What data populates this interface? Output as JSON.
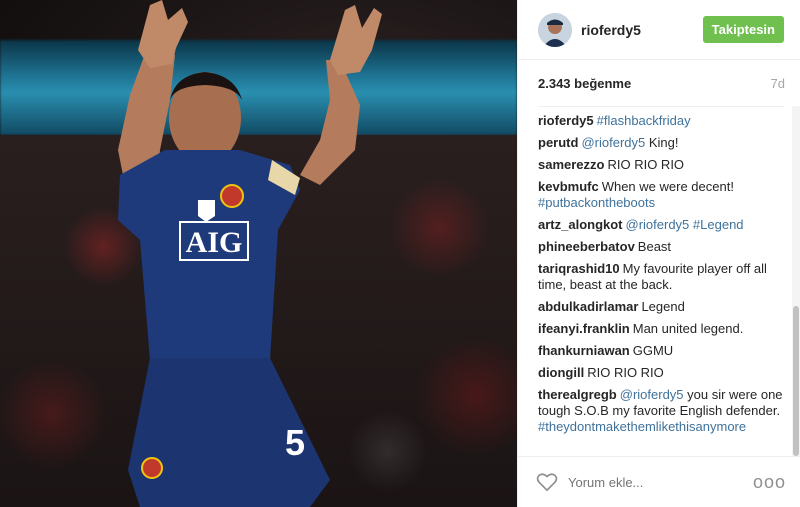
{
  "post": {
    "author": "rioferdy5",
    "follow_label": "Takiptesin",
    "likes": "2.343 beğenme",
    "age": "7d",
    "photo": {
      "shirt_sponsor": "AIG",
      "shirt_number": "5"
    },
    "comments": [
      {
        "user": "rioferdy5",
        "parts": [
          {
            "text": "#flashbackfriday",
            "tag": true
          }
        ]
      },
      {
        "user": "perutd",
        "parts": [
          {
            "text": "@rioferdy5",
            "tag": true
          },
          {
            "text": " King!",
            "tag": false
          }
        ]
      },
      {
        "user": "samerezzo",
        "parts": [
          {
            "text": "RIO RIO RIO",
            "tag": false
          }
        ]
      },
      {
        "user": "kevbmufc",
        "parts": [
          {
            "text": "When we were decent! ",
            "tag": false
          },
          {
            "text": "#putbackontheboots",
            "tag": true
          }
        ]
      },
      {
        "user": "artz_alongkot",
        "parts": [
          {
            "text": "@rioferdy5",
            "tag": true
          },
          {
            "text": " ",
            "tag": false
          },
          {
            "text": "#Legend",
            "tag": true
          }
        ]
      },
      {
        "user": "phineeberbatov",
        "parts": [
          {
            "text": "Beast",
            "tag": false
          }
        ]
      },
      {
        "user": "tariqrashid10",
        "parts": [
          {
            "text": "My favourite player off all time, beast at the back.",
            "tag": false
          }
        ]
      },
      {
        "user": "abdulkadirlamar",
        "parts": [
          {
            "text": "Legend",
            "tag": false
          }
        ]
      },
      {
        "user": "ifeanyi.franklin",
        "parts": [
          {
            "text": "Man united legend.",
            "tag": false
          }
        ]
      },
      {
        "user": "fhankurniawan",
        "parts": [
          {
            "text": "GGMU",
            "tag": false
          }
        ]
      },
      {
        "user": "diongill",
        "parts": [
          {
            "text": "RIO RIO RIO",
            "tag": false
          }
        ]
      },
      {
        "user": "therealgregb",
        "parts": [
          {
            "text": "@rioferdy5",
            "tag": true
          },
          {
            "text": " you sir were one tough S.O.B my favorite English defender. ",
            "tag": false
          },
          {
            "text": "#theydontmakethemlikethisanymore",
            "tag": true
          }
        ]
      }
    ],
    "comment_placeholder": "Yorum ekle...",
    "more_label": "ooo"
  },
  "colors": {
    "follow_button": "#70c050",
    "tag_link": "#3f729b",
    "muted_text": "#a5a7aa",
    "kit_blue": "#1f3a7a"
  },
  "icons": {
    "like": "heart-outline-icon",
    "more": "more-options-icon"
  }
}
